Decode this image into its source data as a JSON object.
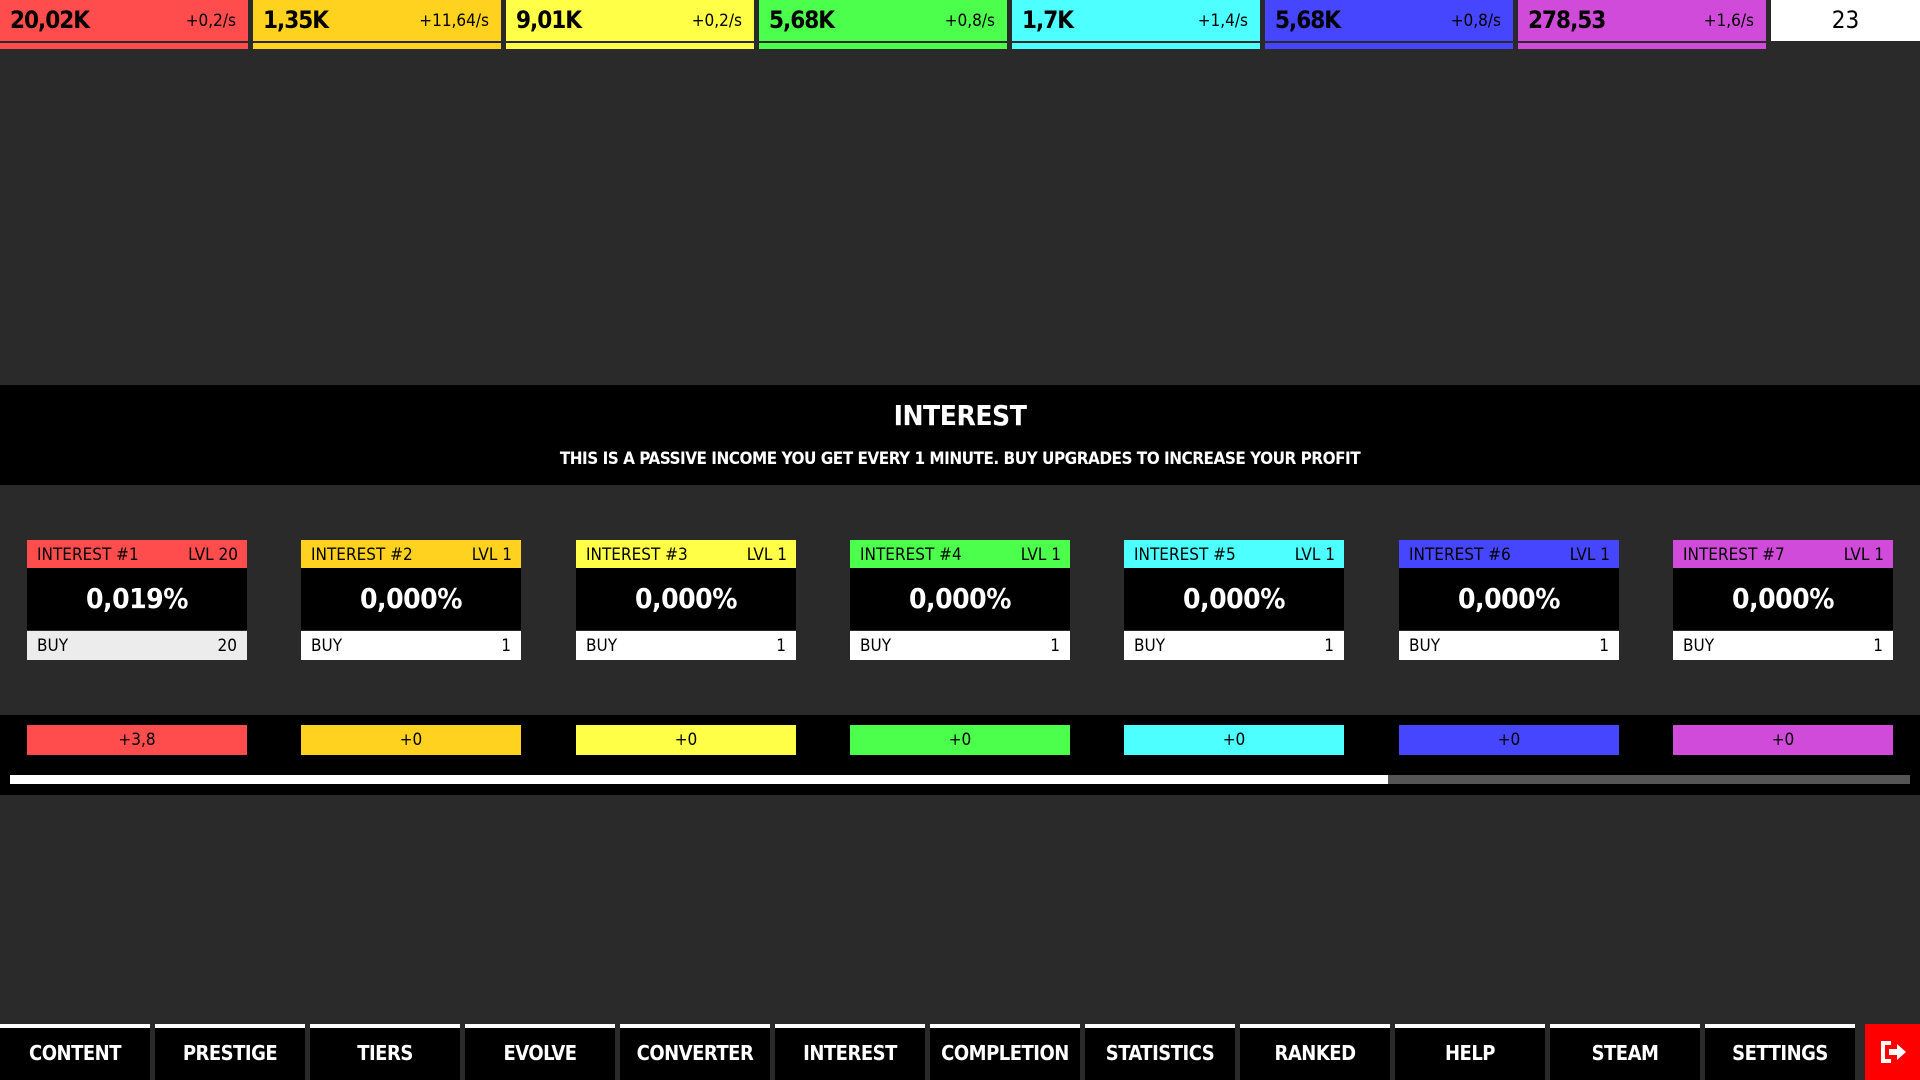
{
  "resources": [
    {
      "amount": "20,02K",
      "rate": "+0,2/s",
      "color": "#ff4d4d"
    },
    {
      "amount": "1,35K",
      "rate": "+11,64/s",
      "color": "#ffd21f"
    },
    {
      "amount": "9,01K",
      "rate": "+0,2/s",
      "color": "#ffff48"
    },
    {
      "amount": "5,68K",
      "rate": "+0,8/s",
      "color": "#4dff4d"
    },
    {
      "amount": "1,7K",
      "rate": "+1,4/s",
      "color": "#4dffff"
    },
    {
      "amount": "5,68K",
      "rate": "+0,8/s",
      "color": "#4646ff"
    },
    {
      "amount": "278,53",
      "rate": "+1,6/s",
      "color": "#d04bd9"
    }
  ],
  "counter": "23",
  "header": {
    "title": "INTEREST",
    "description": "THIS IS A PASSIVE INCOME YOU GET EVERY 1 MINUTE. BUY UPGRADES TO INCREASE YOUR PROFIT"
  },
  "cards": [
    {
      "name": "INTEREST #1",
      "level": "LVL 20",
      "percent": "0,019%",
      "buy_label": "BUY",
      "buy_count": "20",
      "color": "#ff4d4d"
    },
    {
      "name": "INTEREST #2",
      "level": "LVL 1",
      "percent": "0,000%",
      "buy_label": "BUY",
      "buy_count": "1",
      "color": "#ffd21f"
    },
    {
      "name": "INTEREST #3",
      "level": "LVL 1",
      "percent": "0,000%",
      "buy_label": "BUY",
      "buy_count": "1",
      "color": "#ffff48"
    },
    {
      "name": "INTEREST #4",
      "level": "LVL 1",
      "percent": "0,000%",
      "buy_label": "BUY",
      "buy_count": "1",
      "color": "#4dff4d"
    },
    {
      "name": "INTEREST #5",
      "level": "LVL 1",
      "percent": "0,000%",
      "buy_label": "BUY",
      "buy_count": "1",
      "color": "#4dffff"
    },
    {
      "name": "INTEREST #6",
      "level": "LVL 1",
      "percent": "0,000%",
      "buy_label": "BUY",
      "buy_count": "1",
      "color": "#4646ff"
    },
    {
      "name": "INTEREST #7",
      "level": "LVL 1",
      "percent": "0,000%",
      "buy_label": "BUY",
      "buy_count": "1",
      "color": "#d04bd9"
    }
  ],
  "gains": [
    "+3,8",
    "+0",
    "+0",
    "+0",
    "+0",
    "+0",
    "+0"
  ],
  "progress": 0.725,
  "nav": [
    "CONTENT",
    "PRESTIGE",
    "TIERS",
    "EVOLVE",
    "CONVERTER",
    "INTEREST",
    "COMPLETION",
    "STATISTICS",
    "RANKED",
    "HELP",
    "STEAM",
    "SETTINGS"
  ],
  "exit_icon": "exit-icon"
}
